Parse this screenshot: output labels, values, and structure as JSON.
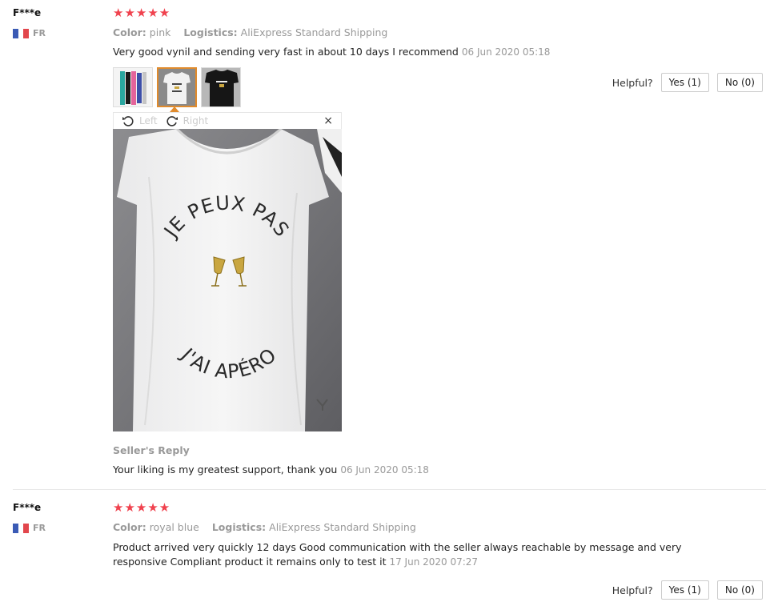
{
  "reviews": [
    {
      "user": "F***e",
      "country": "FR",
      "stars": "★★★★★",
      "color_label": "Color:",
      "color_value": "pink",
      "logistics_label": "Logistics:",
      "logistics_value": "AliExpress Standard Shipping",
      "text": "Very good vynil and sending very fast in about 10 days I recommend",
      "date": "06 Jun 2020 05:18",
      "helpful_label": "Helpful?",
      "yes_label": "Yes (1)",
      "no_label": "No (0)",
      "image_text_top": "JE PEUX PAS",
      "image_text_bottom": "J'AI APÉRO",
      "seller_reply_label": "Seller's Reply",
      "seller_reply_text": "Your liking is my greatest support, thank you",
      "seller_reply_date": "06 Jun 2020 05:18"
    },
    {
      "user": "F***e",
      "country": "FR",
      "stars": "★★★★★",
      "color_label": "Color:",
      "color_value": "royal blue",
      "logistics_label": "Logistics:",
      "logistics_value": "AliExpress Standard Shipping",
      "text_line1": "Product arrived very quickly 12 days Good communication with the seller always reachable by message and very",
      "text_line2": "responsive Compliant product it remains only to test it",
      "date": "17 Jun 2020 07:27",
      "helpful_label": "Helpful?",
      "yes_label": "Yes (1)",
      "no_label": "No (0)"
    }
  ],
  "viewer": {
    "rotate_left_label": "Left",
    "rotate_right_label": "Right",
    "close_symbol": "×"
  },
  "colors": {
    "star": "#f0424e",
    "active_thumb": "#e08b2d",
    "muted": "#999999"
  }
}
